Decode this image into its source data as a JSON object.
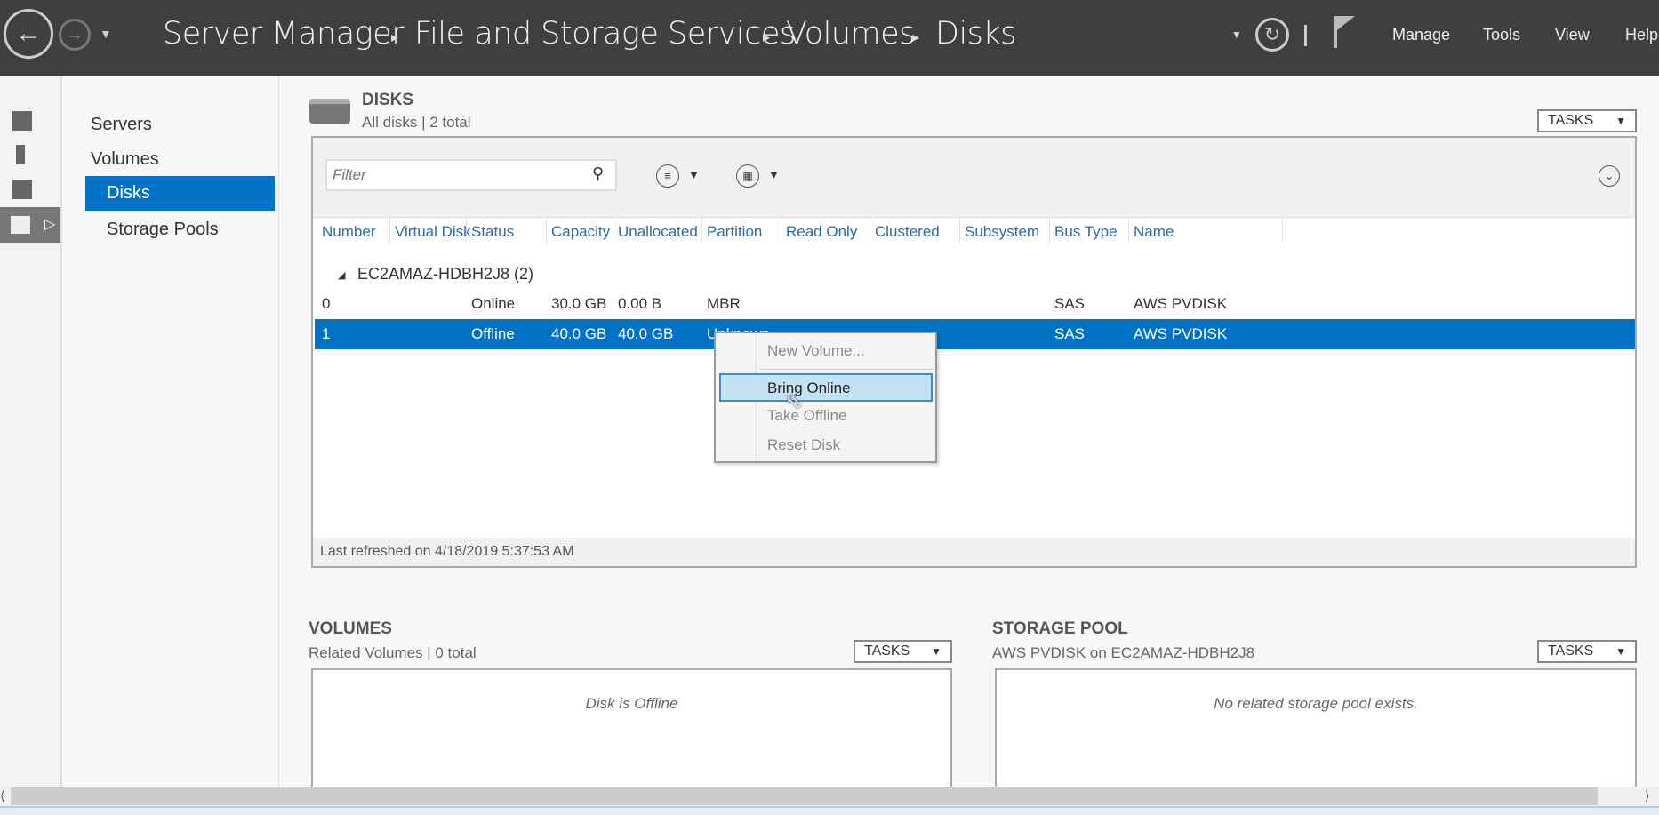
{
  "header": {
    "breadcrumb": [
      "Server Manager",
      "File and Storage Services",
      "Volumes",
      "Disks"
    ],
    "menu": [
      "Manage",
      "Tools",
      "View",
      "Help"
    ]
  },
  "nav": {
    "items": [
      "Servers",
      "Volumes",
      "Disks",
      "Storage Pools"
    ],
    "selected": "Disks",
    "accent": "#0072c6"
  },
  "disks": {
    "title": "DISKS",
    "subtitle": "All disks | 2 total",
    "tasks": "TASKS",
    "filter_placeholder": "Filter",
    "columns": [
      "Number",
      "Virtual Disk",
      "Status",
      "Capacity",
      "Unallocated",
      "Partition",
      "Read Only",
      "Clustered",
      "Subsystem",
      "Bus Type",
      "Name"
    ],
    "group": "EC2AMAZ-HDBH2J8 (2)",
    "rows": [
      {
        "number": "0",
        "status": "Online",
        "capacity": "30.0 GB",
        "unallocated": "0.00 B",
        "partition": "MBR",
        "bus": "SAS",
        "name": "AWS PVDISK"
      },
      {
        "number": "1",
        "status": "Offline",
        "capacity": "40.0 GB",
        "unallocated": "40.0 GB",
        "partition": "Unknown",
        "bus": "SAS",
        "name": "AWS PVDISK",
        "selected": true
      }
    ],
    "last_refreshed": "Last refreshed on 4/18/2019 5:37:53 AM"
  },
  "context_menu": {
    "items": [
      "New Volume...",
      "Bring Online",
      "Take Offline",
      "Reset Disk"
    ],
    "highlighted": "Bring Online"
  },
  "volumes": {
    "title": "VOLUMES",
    "subtitle": "Related Volumes | 0 total",
    "tasks": "TASKS",
    "empty": "Disk is Offline"
  },
  "storage_pool": {
    "title": "STORAGE POOL",
    "subtitle": "AWS PVDISK on EC2AMAZ-HDBH2J8",
    "tasks": "TASKS",
    "empty": "No related storage pool exists."
  }
}
